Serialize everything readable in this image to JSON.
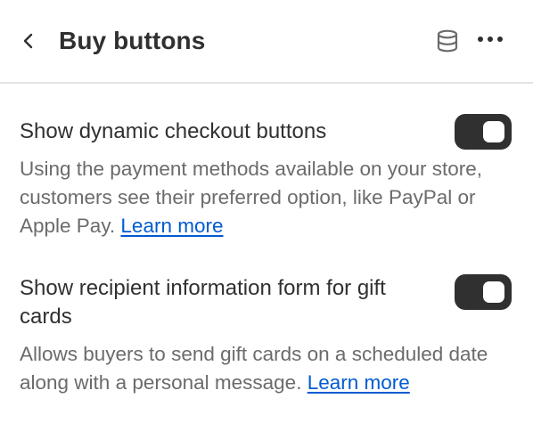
{
  "header": {
    "title": "Buy buttons"
  },
  "settings": [
    {
      "label": "Show dynamic checkout buttons",
      "description": "Using the payment methods available on your store, customers see their preferred option, like PayPal or Apple Pay.",
      "link": "Learn more",
      "enabled": true
    },
    {
      "label": "Show recipient information form for gift cards",
      "description": "Allows buyers to send gift cards on a scheduled date along with a personal message.",
      "link": "Learn more",
      "enabled": true
    }
  ],
  "icons": {
    "back": "chevron-left-icon",
    "database": "database-icon",
    "more": "more-horizontal-icon"
  },
  "colors": {
    "toggle_on": "#303030",
    "link": "#005bd3",
    "text": "#303030",
    "subdued_text": "#6b6b6b"
  }
}
